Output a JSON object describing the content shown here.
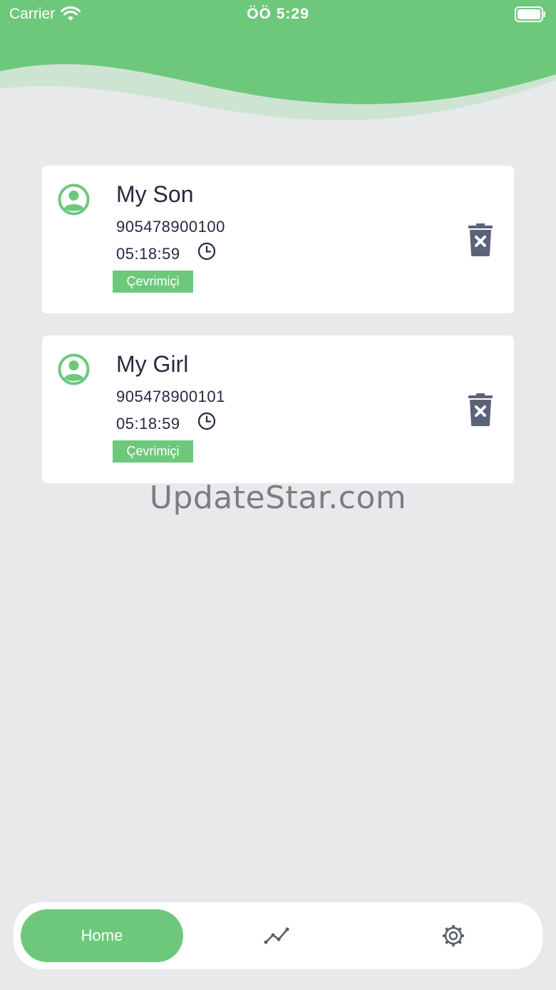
{
  "status_bar": {
    "carrier": "Carrier",
    "time": "ÖÖ 5:29"
  },
  "devices": [
    {
      "name": "My Son",
      "phone": "905478900100",
      "time": "05:18:59",
      "status": "Çevrimiçi"
    },
    {
      "name": "My Girl",
      "phone": "905478900101",
      "time": "05:18:59",
      "status": "Çevrimiçi"
    }
  ],
  "watermark": "UpdateStar.com",
  "tab_bar": {
    "home_label": "Home",
    "stats_icon": "chart-line-icon",
    "settings_icon": "gear-icon"
  },
  "colors": {
    "primary_green": "#6ec87c",
    "light_green": "#cde4d3",
    "background": "#e8e9eb",
    "text_dark": "#262840",
    "icon_slate": "#5a6378"
  }
}
